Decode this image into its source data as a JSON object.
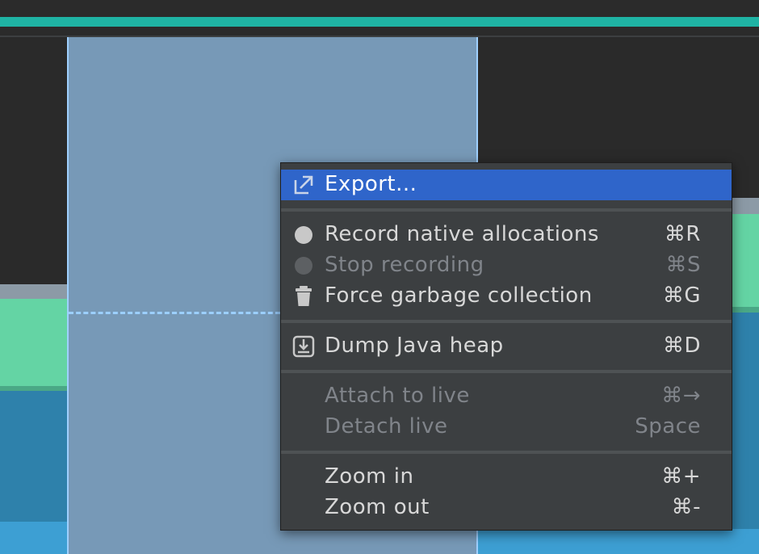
{
  "colors": {
    "accent_teal": "#1fb3a4",
    "selection": "#7799b7",
    "menu_bg": "#3c3f41",
    "menu_highlight": "#2f65ca"
  },
  "context_menu": {
    "items": [
      {
        "label": "Export...",
        "shortcut": "",
        "icon": "export-icon",
        "state": "selected"
      },
      {
        "label": "Record native allocations",
        "shortcut": "⌘R",
        "icon": "record-dot-icon",
        "state": "enabled"
      },
      {
        "label": "Stop recording",
        "shortcut": "⌘S",
        "icon": "stop-dot-icon",
        "state": "disabled"
      },
      {
        "label": "Force garbage collection",
        "shortcut": "⌘G",
        "icon": "trash-icon",
        "state": "enabled"
      },
      {
        "label": "Dump Java heap",
        "shortcut": "⌘D",
        "icon": "heap-dump-icon",
        "state": "enabled"
      },
      {
        "label": "Attach to live",
        "shortcut": "⌘→",
        "icon": "",
        "state": "disabled"
      },
      {
        "label": "Detach live",
        "shortcut": "Space",
        "icon": "",
        "state": "disabled"
      },
      {
        "label": "Zoom in",
        "shortcut": "⌘+",
        "icon": "",
        "state": "enabled"
      },
      {
        "label": "Zoom out",
        "shortcut": "⌘-",
        "icon": "",
        "state": "enabled"
      }
    ]
  }
}
